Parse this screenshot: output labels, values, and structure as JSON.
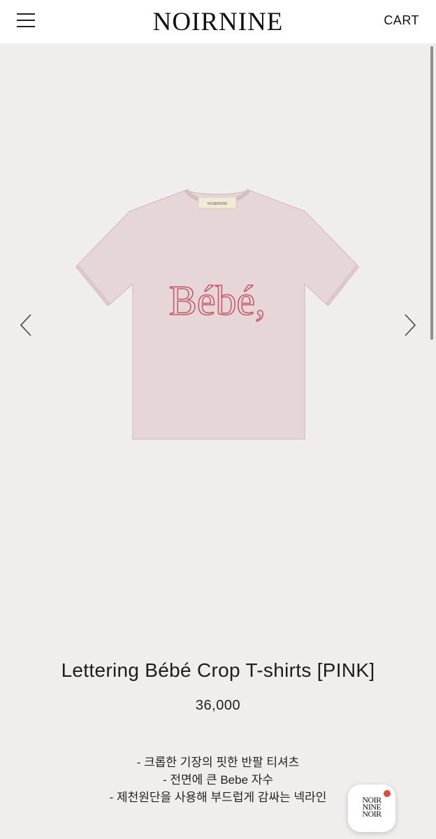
{
  "header": {
    "logo": "NOIRNINE",
    "cart_label": "CART",
    "menu_icon": "hamburger-icon"
  },
  "gallery": {
    "prev_icon": "chevron-left-icon",
    "next_icon": "chevron-right-icon",
    "product_color": "#e7d6d7",
    "print_text": "Bébé,",
    "label_text": "NOIRNINE"
  },
  "product": {
    "title": "Lettering Bébé Crop T-shirts [PINK]",
    "price": "36,000",
    "description": [
      "- 크롭한 기장의 핏한 반팔 티셔츠",
      "- 전면에 큰 Bebe 자수",
      "- 제천원단을 사용해 부드럽게 감싸는 넥라인"
    ]
  },
  "chat_button": {
    "lines": [
      "NOIR",
      "NINE",
      "NOIR"
    ],
    "badge_color": "#e24a36"
  }
}
